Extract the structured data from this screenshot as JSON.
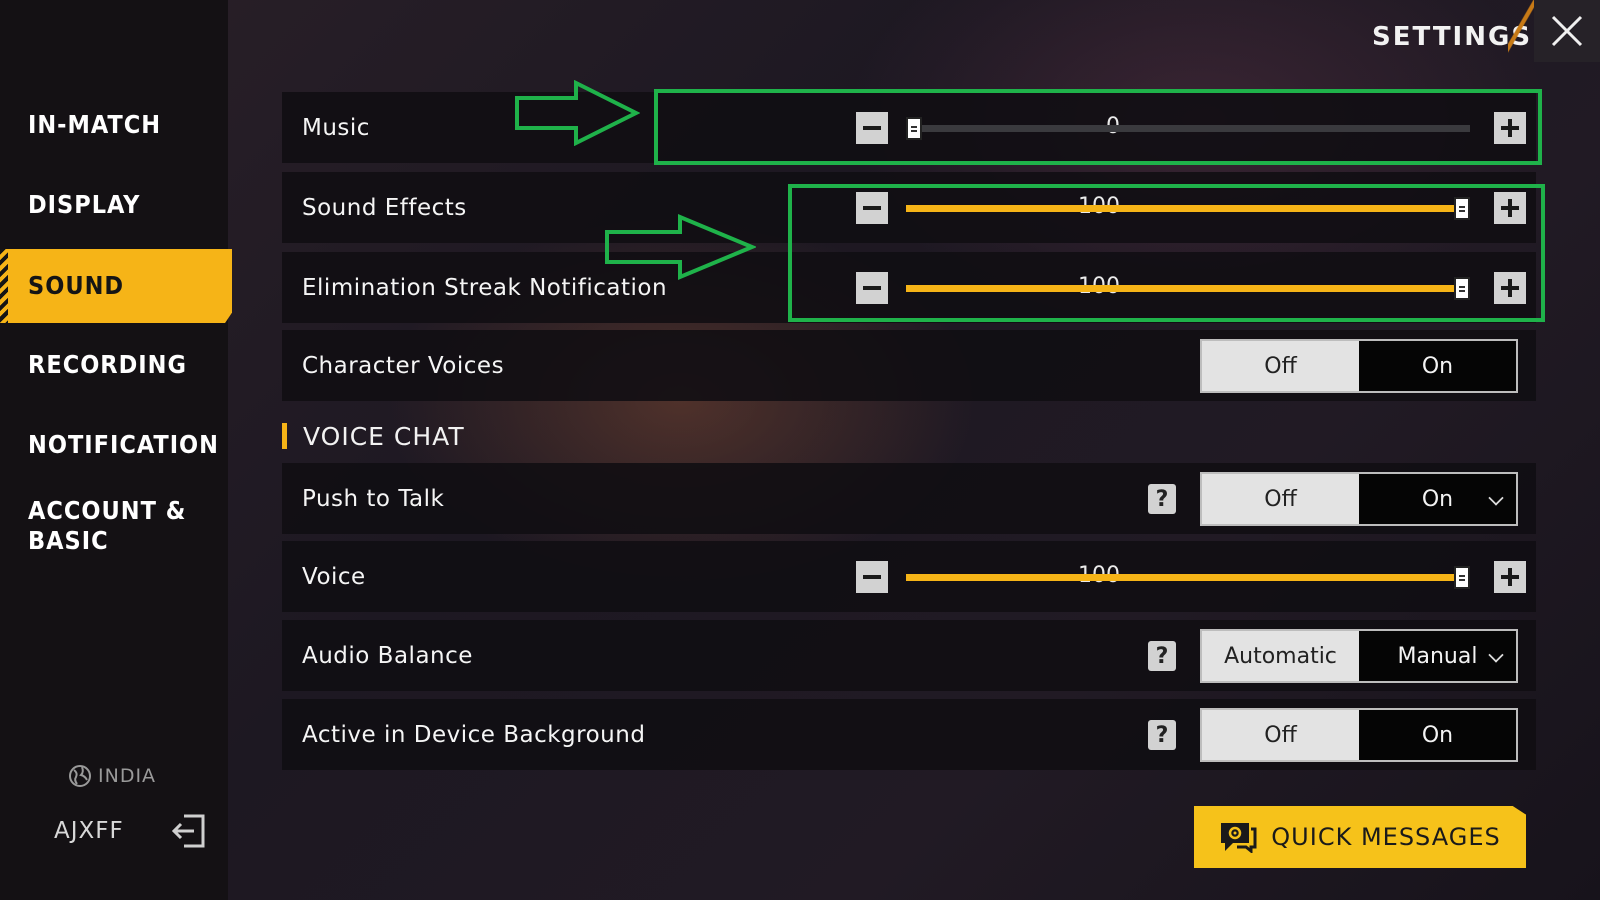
{
  "header": {
    "title": "SETTINGS"
  },
  "sidebar": {
    "items": [
      {
        "label": "IN-MATCH"
      },
      {
        "label": "DISPLAY"
      },
      {
        "label": "SOUND",
        "active": true
      },
      {
        "label": "RECORDING"
      },
      {
        "label": "NOTIFICATION"
      },
      {
        "label_line1": "ACCOUNT &",
        "label_line2": "BASIC"
      }
    ],
    "region": "INDIA",
    "username": "AJXFF"
  },
  "sound": {
    "music": {
      "label": "Music",
      "value": "0",
      "fraction": 0.0
    },
    "sound_effects": {
      "label": "Sound Effects",
      "value": "100",
      "fraction": 1.0
    },
    "elimination_streak": {
      "label": "Elimination Streak Notification",
      "value": "100",
      "fraction": 1.0
    },
    "character_voices": {
      "label": "Character Voices",
      "off": "Off",
      "on": "On",
      "selected": "On"
    }
  },
  "voice_chat": {
    "section_title": "VOICE CHAT",
    "push_to_talk": {
      "label": "Push to Talk",
      "off": "Off",
      "on": "On",
      "selected": "On"
    },
    "voice": {
      "label": "Voice",
      "value": "100",
      "fraction": 1.0
    },
    "audio_balance": {
      "label": "Audio Balance",
      "opt1": "Automatic",
      "opt2": "Manual",
      "selected": "Manual"
    },
    "active_background": {
      "label": "Active in Device Background",
      "off": "Off",
      "on": "On",
      "selected": "On"
    },
    "help_glyph": "?"
  },
  "quick_messages": {
    "label": "QUICK MESSAGES"
  },
  "colors": {
    "accent": "#f6b417",
    "highlight": "#1fb24a"
  }
}
